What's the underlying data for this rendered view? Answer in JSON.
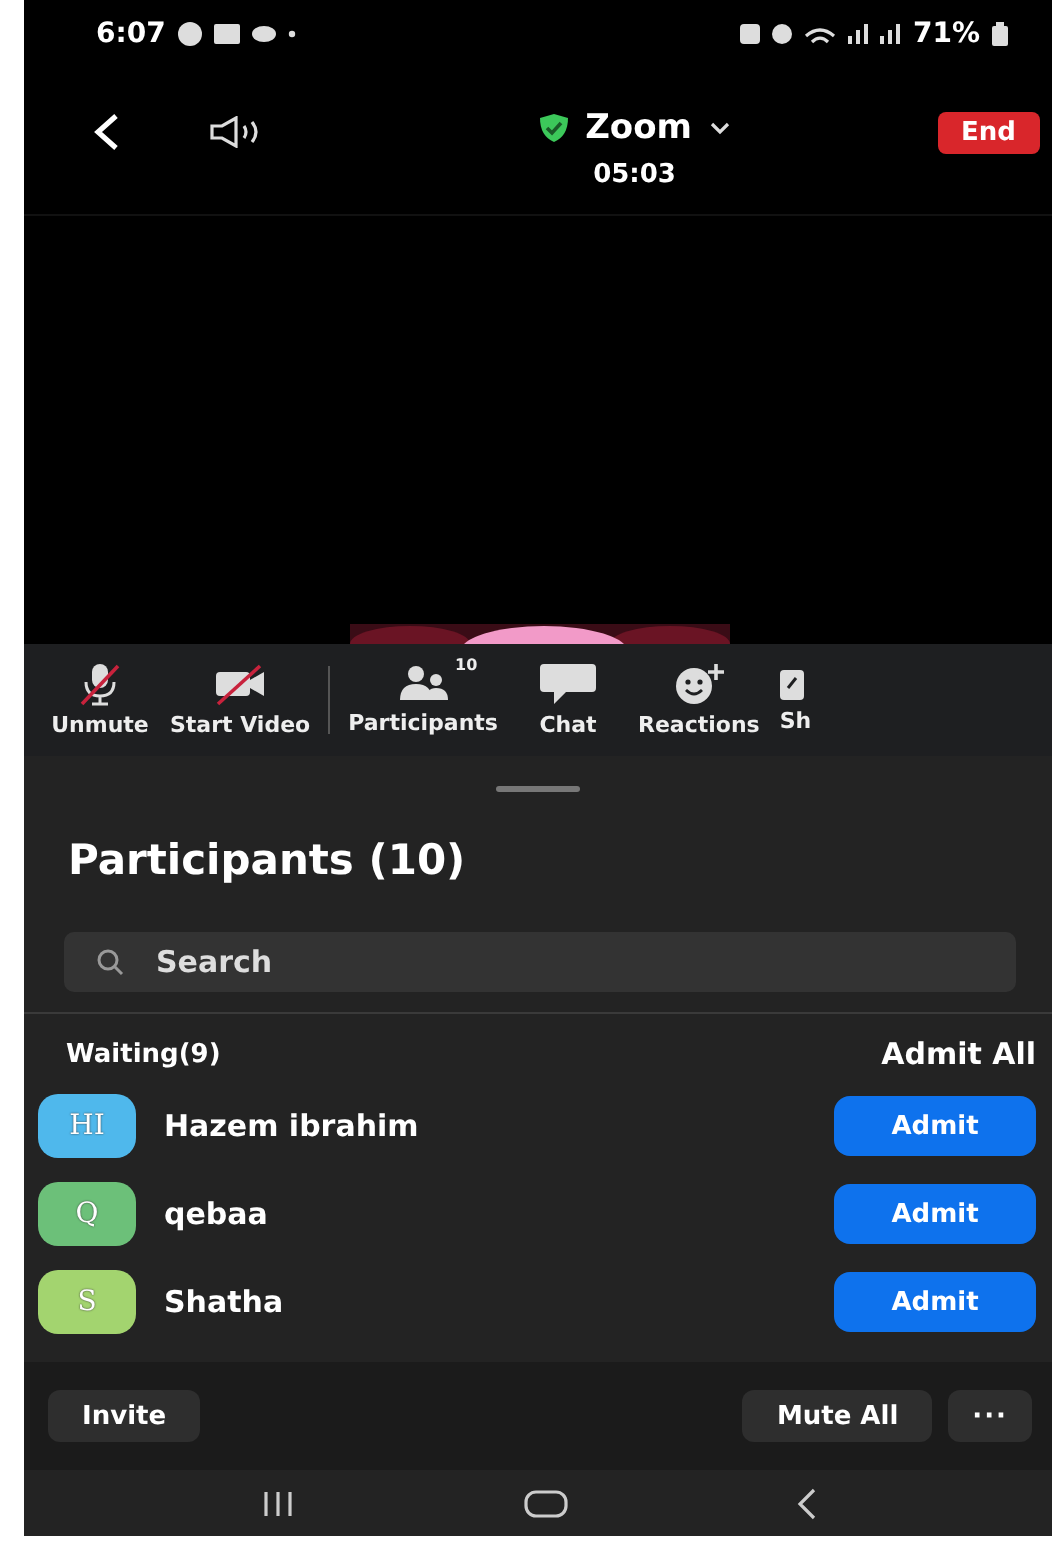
{
  "status_bar": {
    "time": "6:07",
    "battery": "71%"
  },
  "header": {
    "title": "Zoom",
    "timer": "05:03",
    "end_button": "End"
  },
  "toolbar": [
    {
      "kind": "mic-muted",
      "label": "Unmute"
    },
    {
      "kind": "video-off",
      "label": "Start Video"
    },
    {
      "kind": "participants",
      "label": "Participants",
      "badge": "10"
    },
    {
      "kind": "chat",
      "label": "Chat"
    },
    {
      "kind": "reactions",
      "label": "Reactions"
    },
    {
      "kind": "share",
      "label": "Sh"
    }
  ],
  "panel": {
    "title": "Participants (10)",
    "search": {
      "placeholder": "Search"
    },
    "waiting": {
      "label": "Waiting(9)",
      "admit_all": "Admit All",
      "people": [
        {
          "initials": "HI",
          "name": "Hazem ibrahim",
          "color": "#4fb8ec",
          "action": "Admit"
        },
        {
          "initials": "Q",
          "name": "qebaa",
          "color": "#6cc079",
          "action": "Admit"
        },
        {
          "initials": "S",
          "name": "Shatha",
          "color": "#a3d46f",
          "action": "Admit"
        }
      ]
    },
    "footer": {
      "invite": "Invite",
      "mute_all": "Mute All",
      "more": "···"
    }
  }
}
